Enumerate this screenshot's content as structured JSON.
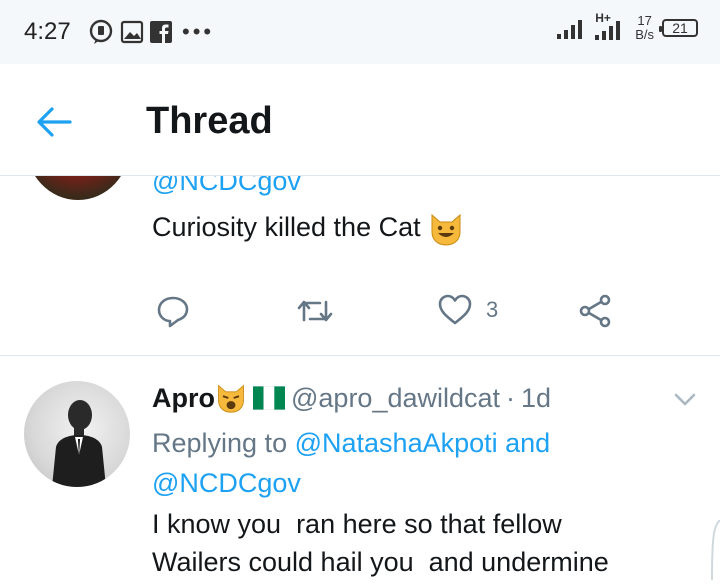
{
  "status_bar": {
    "time": "4:27",
    "network": "H+",
    "speed_value": "17",
    "speed_unit": "B/s",
    "battery": "21",
    "notification_icons": [
      "chat-bubble-icon",
      "image-icon",
      "facebook-icon",
      "more-dots-icon"
    ]
  },
  "header": {
    "title": "Thread",
    "back_icon": "arrow-left-icon"
  },
  "tweet1": {
    "handle": "@NCDCgov",
    "text": "Curiosity killed the Cat",
    "emoji": "grinning-cat-face",
    "actions": {
      "reply_icon": "reply-icon",
      "retweet_icon": "retweet-icon",
      "like_icon": "heart-icon",
      "like_count": "3",
      "share_icon": "share-icon"
    }
  },
  "tweet2": {
    "name": "Apro",
    "name_emoji": "weary-cat-face",
    "flag": "nigeria-flag",
    "handle": "@apro_dawildcat",
    "separator": "·",
    "time": "1d",
    "replying_prefix": "Replying to",
    "reply_to_1": "@NatashaAkpoti",
    "reply_conjunction": "and",
    "reply_to_2": "@NCDCgov",
    "text_line1": "I know you  ran here so that fellow",
    "text_line2": "Wailers could hail you  and undermine"
  },
  "colors": {
    "accent": "#1da1f2",
    "text": "#14171a",
    "secondary": "#657786",
    "divider": "#e1e8ed",
    "status_bg": "#f5f8fa"
  }
}
